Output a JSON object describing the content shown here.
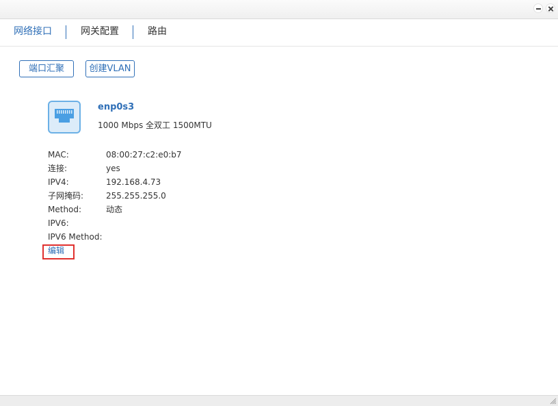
{
  "window": {
    "minimize_icon": "minimize-icon",
    "close_icon": "close-icon"
  },
  "tabs": [
    {
      "label": "网络接口",
      "active": true
    },
    {
      "label": "网关配置",
      "active": false
    },
    {
      "label": "路由",
      "active": false
    }
  ],
  "toolbar": {
    "bond_label": "端口汇聚",
    "vlan_label": "创建VLAN"
  },
  "interface": {
    "icon": "ethernet-port-icon",
    "name": "enp0s3",
    "description": "1000 Mbps 全双工 1500MTU",
    "fields": [
      {
        "label": "MAC:",
        "value": "08:00:27:c2:e0:b7"
      },
      {
        "label": "连接:",
        "value": "yes"
      },
      {
        "label": "IPV4:",
        "value": "192.168.4.73"
      },
      {
        "label": "子网掩码:",
        "value": "255.255.255.0"
      },
      {
        "label": "Method:",
        "value": "动态"
      },
      {
        "label": "IPV6:",
        "value": ""
      },
      {
        "label": "IPV6 Method:",
        "value": ""
      }
    ],
    "edit_label": "编辑"
  },
  "colors": {
    "accent": "#2f6fb7",
    "highlight": "#e0302e",
    "icon_border": "#6bb0e6",
    "icon_fill": "#dcecf9"
  }
}
